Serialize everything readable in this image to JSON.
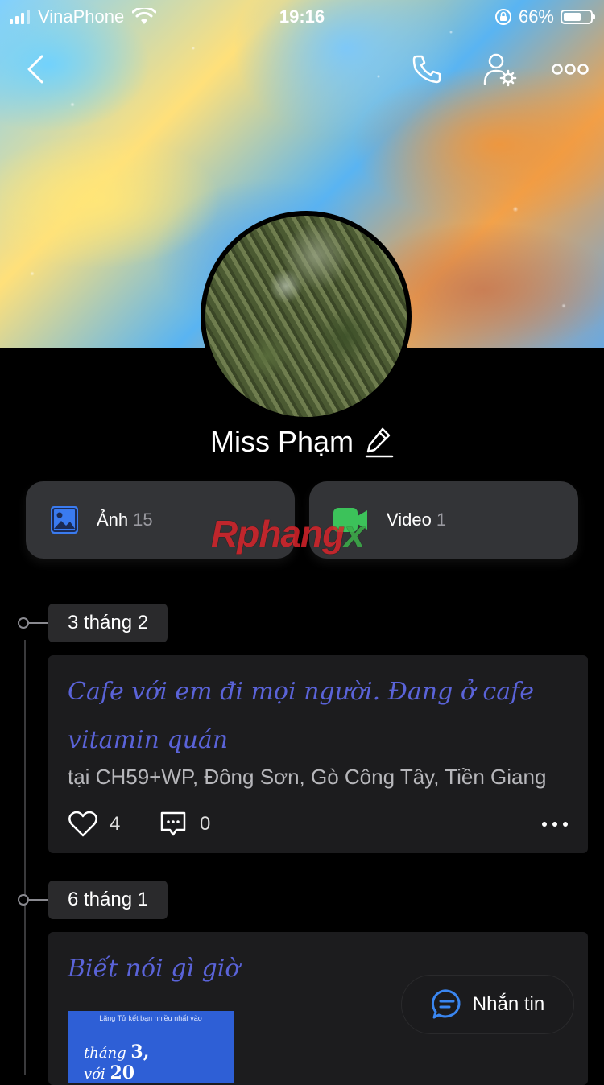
{
  "status_bar": {
    "carrier": "VinaPhone",
    "time": "19:16",
    "battery": "66%",
    "battery_level": 0.66
  },
  "header": {
    "icons": [
      "back-icon",
      "phone-icon",
      "user-settings-icon",
      "more-icon"
    ]
  },
  "profile": {
    "name": "Miss Phạm"
  },
  "media": {
    "photos_label": "Ảnh",
    "photos_count": "15",
    "videos_label": "Video",
    "videos_count": "1"
  },
  "watermark": {
    "part1": "Rphang",
    "part2": "x"
  },
  "posts": [
    {
      "date": "3 tháng 2",
      "text": "Cafe với em đi mọi người. Đang ở cafe vitamin quán",
      "location": "tại CH59+WP, Đông Sơn, Gò Công Tây, Tiền Giang",
      "likes": "4",
      "comments": "0"
    },
    {
      "date": "6 tháng 1",
      "text": "Biết nói gì giờ",
      "thumb_small": "Lãng Tử kết bạn nhiều nhất vào",
      "thumb_line1": "tháng",
      "thumb_num1": "3,",
      "thumb_line2": "với",
      "thumb_num2": "20"
    }
  ],
  "message_button": {
    "label": "Nhắn tin"
  },
  "colors": {
    "background": "#000000",
    "card": "#1c1c1e",
    "post_text": "#5a63d8",
    "photo_icon": "#3a7bf0",
    "video_icon": "#3cc25a",
    "message_icon": "#3a86f0"
  }
}
